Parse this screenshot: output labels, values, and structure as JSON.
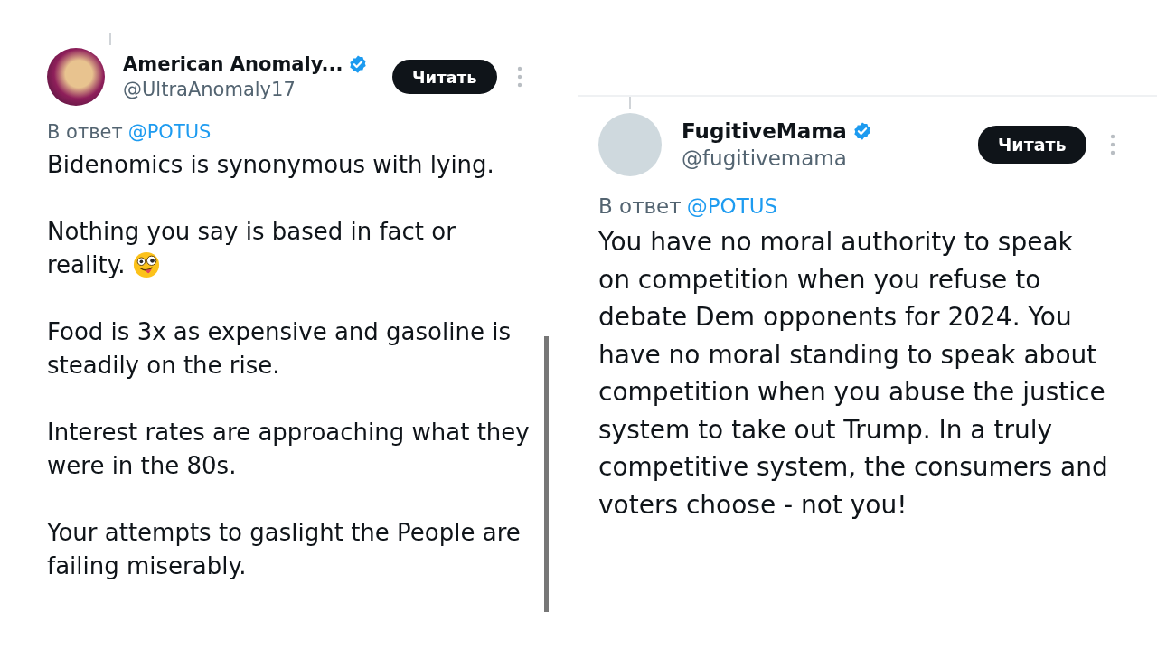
{
  "tweets": [
    {
      "avatar": {
        "kind": "photo"
      },
      "name": "American Anomaly...",
      "verified": true,
      "handle": "@UltraAnomaly17",
      "follow_button": "Читать",
      "reply_prefix": "В ответ",
      "reply_to": "@POTUS",
      "paragraphs": [
        {
          "text": "Bidenomics is synonymous with lying."
        },
        {
          "text": "Nothing you say is based in fact or reality.",
          "emoji": {
            "kind": "wink_tongue"
          }
        },
        {
          "text": "Food is 3x as expensive and gasoline is steadily on the rise."
        },
        {
          "text": "Interest rates are approaching what they were in the 80s."
        },
        {
          "text": "Your attempts to gaslight the People are failing miserably."
        }
      ]
    },
    {
      "avatar": {
        "kind": "blank"
      },
      "name": "FugitiveMama",
      "verified": true,
      "handle": "@fugitivemama",
      "follow_button": "Читать",
      "reply_prefix": "В ответ",
      "reply_to": "@POTUS",
      "paragraphs": [
        {
          "text": "You have no moral authority to speak on competition when you refuse to debate Dem opponents for 2024. You have no moral standing to speak about competition when you abuse the justice system to take out Trump. In a truly competitive system, the consumers and voters choose - not you!"
        }
      ]
    }
  ]
}
